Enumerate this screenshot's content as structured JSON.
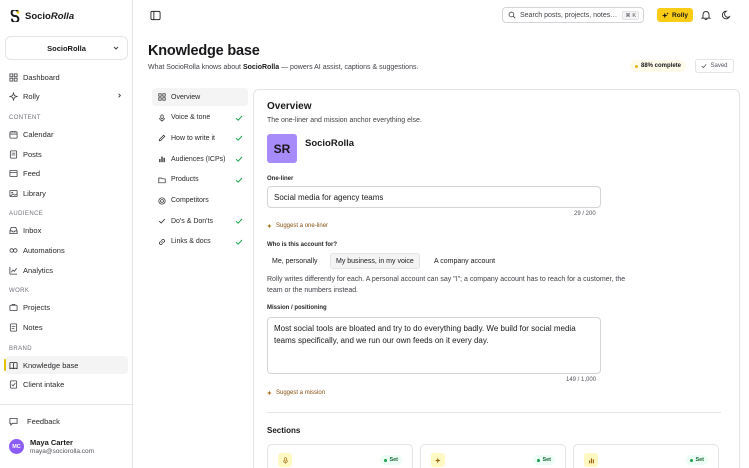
{
  "app": {
    "brand_plain": "Socio",
    "brand_italic": "Rolla"
  },
  "workspace": {
    "name": "SocioRolla"
  },
  "sidebar": {
    "top_items": [
      {
        "label": "Dashboard",
        "icon": "dashboard-icon"
      },
      {
        "label": "Rolly",
        "icon": "rolly-icon"
      }
    ],
    "sections": [
      {
        "label": "CONTENT",
        "items": [
          {
            "label": "Calendar",
            "icon": "calendar-icon"
          },
          {
            "label": "Posts",
            "icon": "posts-icon"
          },
          {
            "label": "Feed",
            "icon": "feed-icon"
          },
          {
            "label": "Library",
            "icon": "library-icon"
          }
        ]
      },
      {
        "label": "AUDIENCE",
        "items": [
          {
            "label": "Inbox",
            "icon": "inbox-icon"
          },
          {
            "label": "Automations",
            "icon": "automations-icon"
          },
          {
            "label": "Analytics",
            "icon": "analytics-icon"
          }
        ]
      },
      {
        "label": "WORK",
        "items": [
          {
            "label": "Projects",
            "icon": "projects-icon"
          },
          {
            "label": "Notes",
            "icon": "notes-icon"
          }
        ]
      },
      {
        "label": "BRAND",
        "items": [
          {
            "label": "Knowledge base",
            "icon": "book-icon",
            "active": true
          },
          {
            "label": "Client intake",
            "icon": "intake-icon"
          }
        ]
      }
    ],
    "feedback_label": "Feedback",
    "user": {
      "initials": "MC",
      "name": "Maya Carter",
      "email": "maya@sociorolla.com"
    }
  },
  "topbar": {
    "search_placeholder": "Search posts, projects, notes…",
    "search_shortcut": "⌘ K",
    "rolly_label": "Rolly"
  },
  "page": {
    "title": "Knowledge base",
    "subtitle_pre": "What SocioRolla knows about ",
    "subtitle_bold": "SocioRolla",
    "subtitle_post": " — powers AI assist, captions & suggestions.",
    "complete_label": "88% complete",
    "saved_label": "Saved"
  },
  "kb_nav": [
    {
      "label": "Overview",
      "icon": "grid-icon",
      "active": true,
      "done": false
    },
    {
      "label": "Voice & tone",
      "icon": "mic-icon",
      "done": true
    },
    {
      "label": "How to write it",
      "icon": "pen-icon",
      "done": true
    },
    {
      "label": "Audiences (ICPs)",
      "icon": "bar-icon",
      "done": true
    },
    {
      "label": "Products",
      "icon": "folder-icon",
      "done": true
    },
    {
      "label": "Competitors",
      "icon": "target-icon",
      "done": false
    },
    {
      "label": "Do's & Don'ts",
      "icon": "check-icon",
      "done": true
    },
    {
      "label": "Links & docs",
      "icon": "link-icon",
      "done": true
    }
  ],
  "overview": {
    "title": "Overview",
    "subtitle": "The one-liner and mission anchor everything else.",
    "logo_initials": "SR",
    "account_name": "SocioRolla",
    "one_liner_label": "One-liner",
    "one_liner_value": "Social media for agency teams",
    "one_liner_count": "29 / 200",
    "suggest_one_liner": "Suggest a one-liner",
    "who_label": "Who is this account for?",
    "who_options": [
      "Me, personally",
      "My business, in my voice",
      "A company account"
    ],
    "who_selected": 1,
    "who_helper": "Rolly writes differently for each. A personal account can say \"I\"; a company account has to reach for a customer, the team or the numbers instead.",
    "mission_label": "Mission / positioning",
    "mission_value": "Most social tools are bloated and try to do everything badly. We build for social media teams specifically, and we run our own feeds on it every day.",
    "mission_count": "149 / 1,000",
    "suggest_mission": "Suggest a mission",
    "sections_title": "Sections",
    "section_tiles": [
      {
        "icon": "mic-icon",
        "status": "Set"
      },
      {
        "icon": "pen-icon",
        "status": "Set"
      },
      {
        "icon": "bar-icon",
        "status": "Set"
      }
    ]
  },
  "colors": {
    "accent": "#facc15",
    "avatar": "#8b5cf6",
    "logo": "#a78bfa",
    "check": "#16a34a"
  }
}
